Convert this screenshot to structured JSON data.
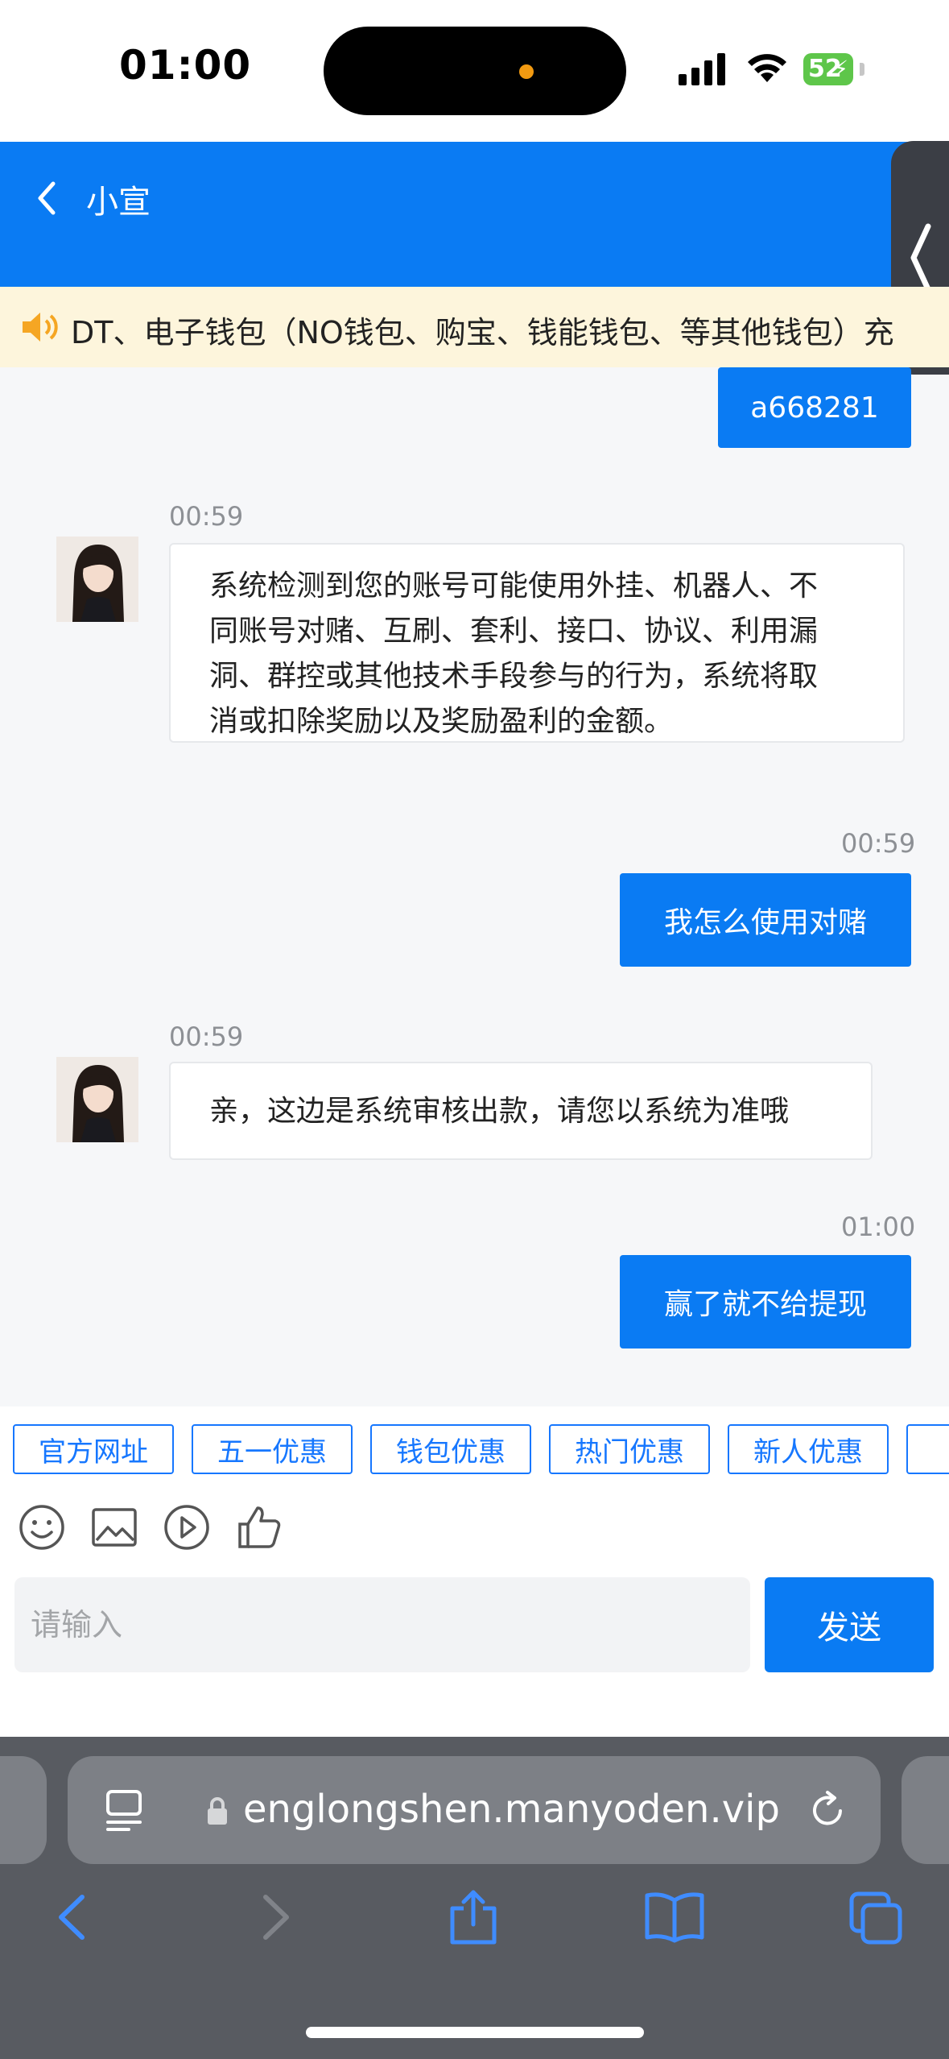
{
  "status": {
    "time": "01:00",
    "battery": "52"
  },
  "header": {
    "title": "小宣"
  },
  "notice": {
    "text": "DT、电子钱包（NO钱包、购宝、钱能钱包、等其他钱包）充"
  },
  "chat": {
    "messages": [
      {
        "side": "right",
        "text": "a668281"
      },
      {
        "side": "left",
        "time": "00:59",
        "lines": [
          "系统检测到您的账号可能使用外挂、机器人、不",
          "同账号对赌、互刷、套利、接口、协议、利用漏",
          "洞、群控或其他技术手段参与的行为，系统将取",
          "消或扣除奖励以及奖励盈利的金额。"
        ]
      },
      {
        "side": "right",
        "time": "00:59",
        "text": "我怎么使用对赌"
      },
      {
        "side": "left",
        "time": "00:59",
        "text": "亲，这边是系统审核出款，请您以系统为准哦"
      },
      {
        "side": "right",
        "time": "01:00",
        "text": "赢了就不给提现"
      }
    ]
  },
  "quick_tags": [
    "官方网址",
    "五一优惠",
    "钱包优惠",
    "热门优惠",
    "新人优惠"
  ],
  "input": {
    "placeholder": "请输入",
    "send_label": "发送"
  },
  "browser": {
    "url": "englongshen.manyoden.vip"
  },
  "colors": {
    "primary": "#0a7bf3",
    "notice_bg": "#fdf5dc",
    "browser_bg": "#585b61"
  }
}
